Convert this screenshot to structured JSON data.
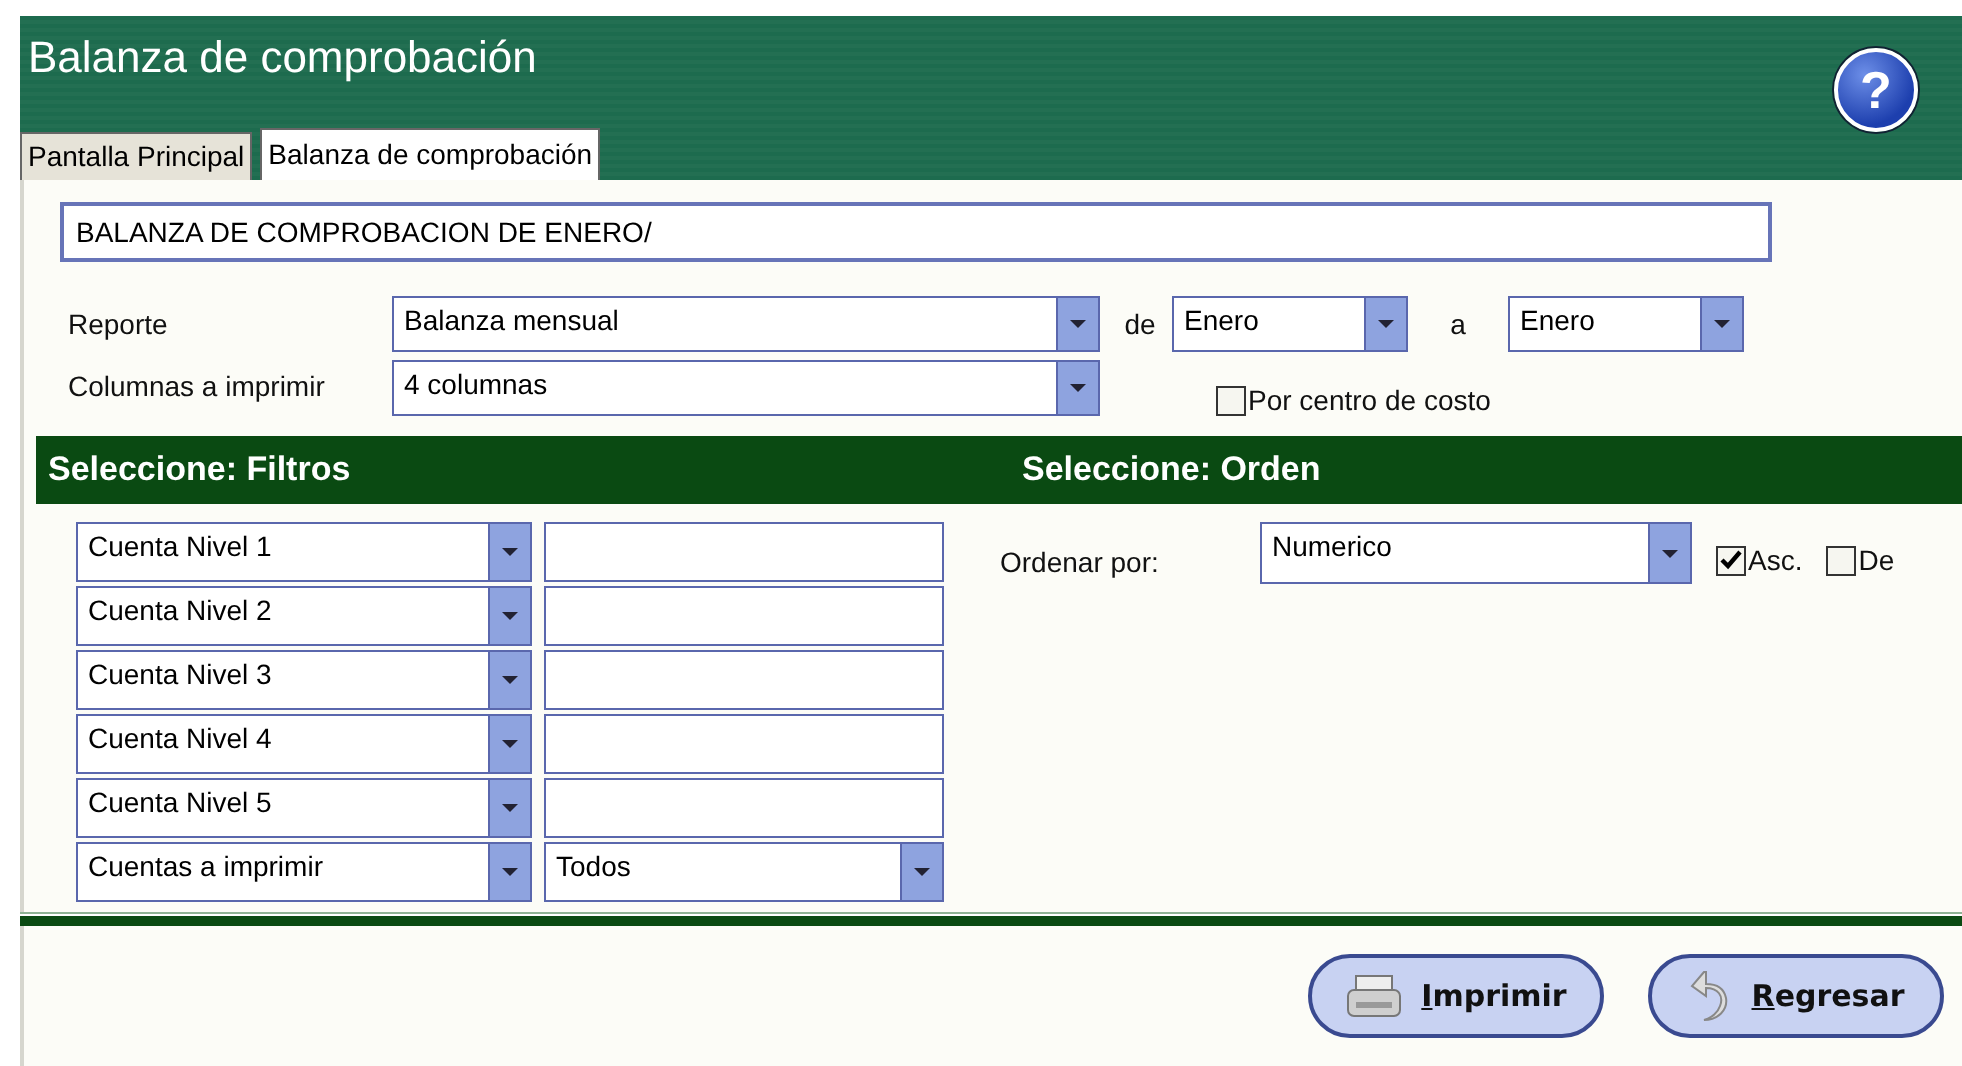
{
  "window": {
    "title": "Balanza de comprobación",
    "help": "?"
  },
  "tabs": [
    {
      "label": "Pantalla Principal",
      "selected": false
    },
    {
      "label": "Balanza de comprobación",
      "selected": true
    }
  ],
  "description": {
    "value": "BALANZA DE COMPROBACION DE ENERO/"
  },
  "report": {
    "label": "Reporte",
    "value": "Balanza mensual",
    "from_label": "de",
    "from": "Enero",
    "to_label": "a",
    "to": "Enero"
  },
  "columns": {
    "label": "Columnas a imprimir",
    "value": "4 columnas"
  },
  "cost_center": {
    "label": "Por centro de costo",
    "checked": false
  },
  "filters": {
    "title": "Seleccione: Filtros",
    "rows": [
      {
        "kind": "text",
        "field": "Cuenta Nivel 1"
      },
      {
        "kind": "text",
        "field": "Cuenta Nivel 2"
      },
      {
        "kind": "text",
        "field": "Cuenta Nivel 3"
      },
      {
        "kind": "text",
        "field": "Cuenta Nivel 4"
      },
      {
        "kind": "text",
        "field": "Cuenta Nivel 5"
      },
      {
        "kind": "select",
        "field": "Cuentas a imprimir",
        "value": "Todos"
      }
    ]
  },
  "order": {
    "title": "Seleccione: Orden",
    "label": "Ordenar por:",
    "value": "Numerico",
    "options": [
      {
        "label": "Asc.",
        "checked": true
      },
      {
        "label": "De",
        "checked": false
      }
    ]
  },
  "buttons": [
    {
      "kind": "print",
      "label": "Imprimir"
    },
    {
      "kind": "back",
      "label": "Regresar"
    }
  ]
}
